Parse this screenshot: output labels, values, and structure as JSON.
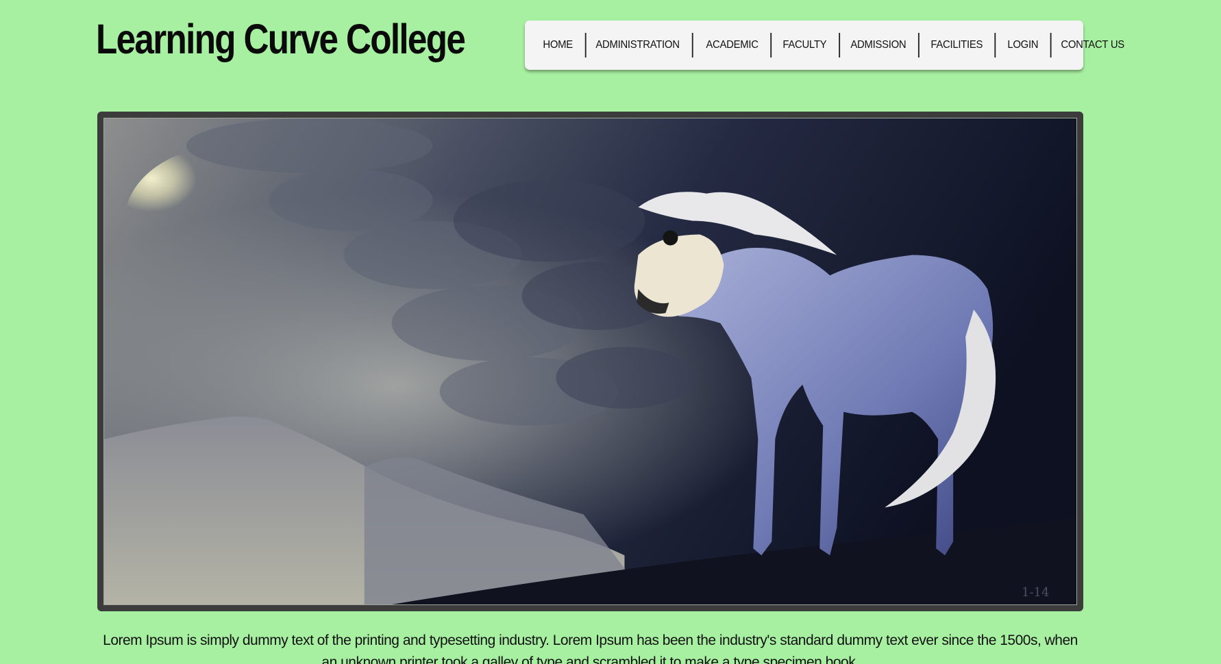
{
  "header": {
    "title": "Learning Curve College"
  },
  "nav": {
    "items": [
      {
        "label": "HOME"
      },
      {
        "label": "ADMINISTRATION"
      },
      {
        "label": "ACADEMIC"
      },
      {
        "label": "FACULTY"
      },
      {
        "label": "ADMISSION"
      },
      {
        "label": "FACILITIES"
      },
      {
        "label": "LOGIN"
      },
      {
        "label": "CONTACT US"
      }
    ]
  },
  "hero": {
    "image_description_icon": "horse-skull-storm-painting",
    "signature": "1-14"
  },
  "intro": {
    "text": "Lorem Ipsum is simply dummy text of the printing and typesetting industry. Lorem Ipsum has been the industry's standard dummy text ever since the 1500s, when an unknown printer took a galley of type and scrambled it to make a type specimen book."
  },
  "colors": {
    "background": "#a8f0a1",
    "nav_bg": "#f4f4f4",
    "frame": "#3c3c3c"
  }
}
